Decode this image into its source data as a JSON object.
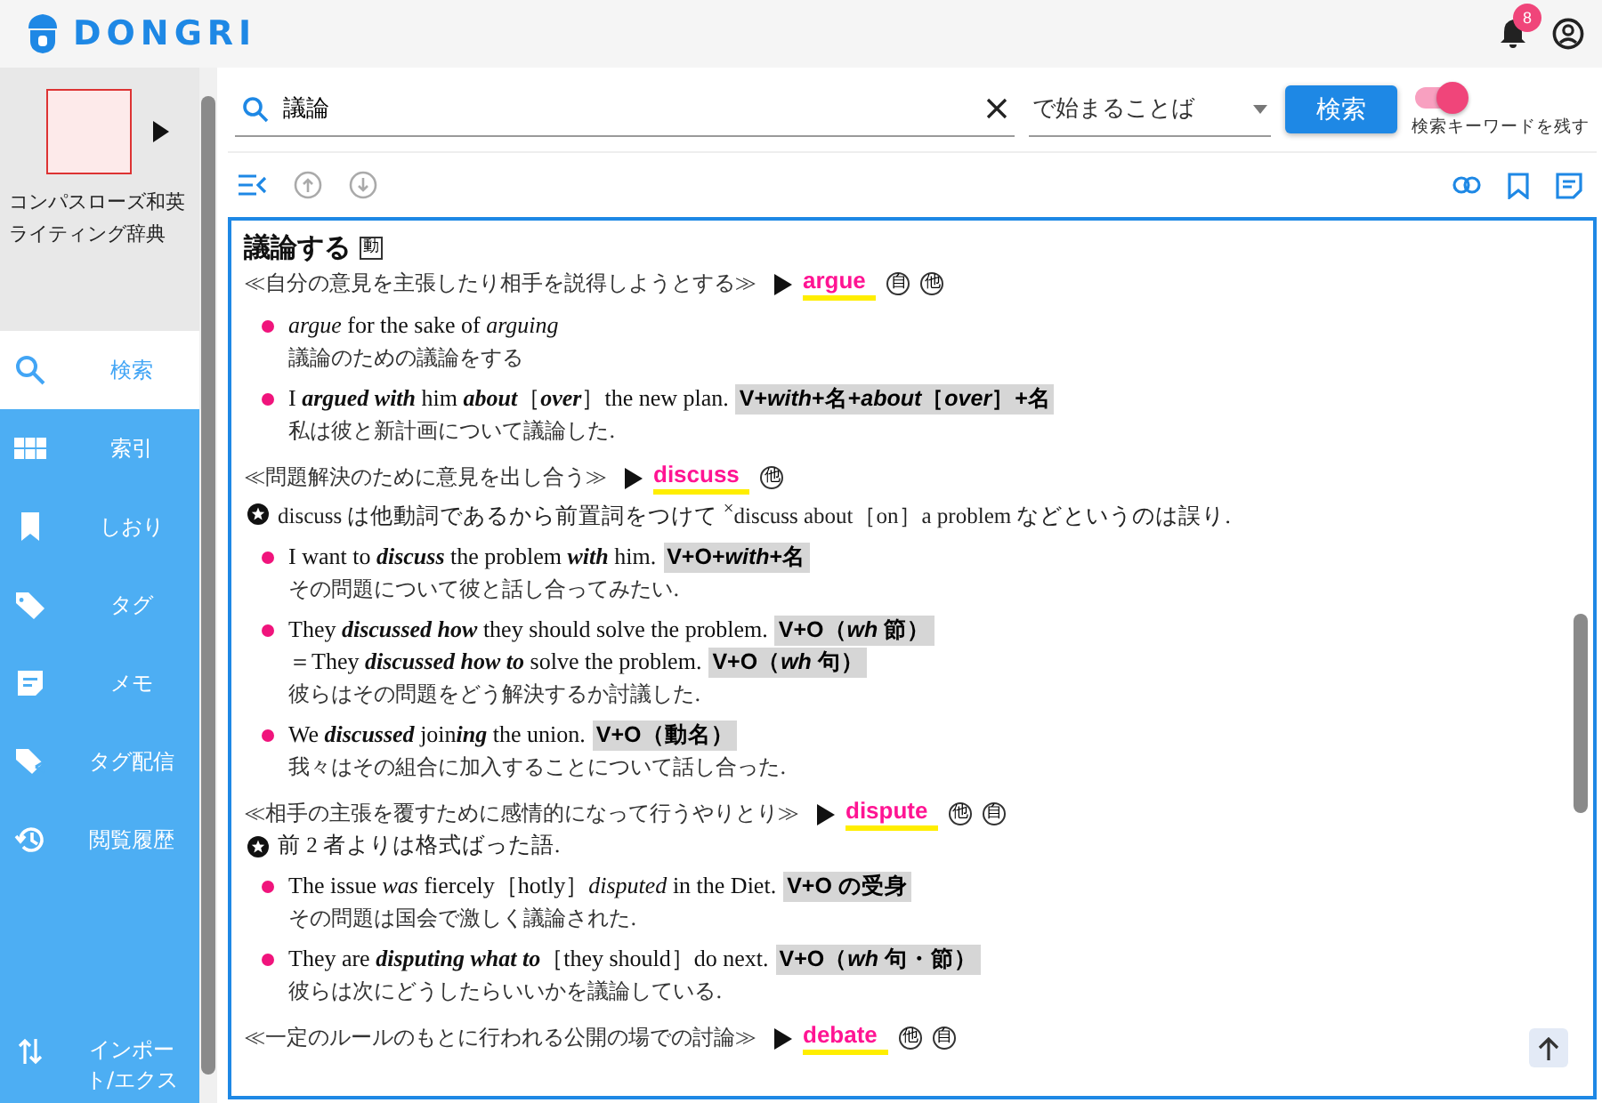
{
  "header": {
    "brand": "DONGRI",
    "notifications": "8"
  },
  "sidebar": {
    "dictionary": {
      "title": "コンパスローズ和英ライティング辞典"
    },
    "items": [
      {
        "label": "検索",
        "selected": true
      },
      {
        "label": "索引",
        "selected": false
      },
      {
        "label": "しおり",
        "selected": false
      },
      {
        "label": "タグ",
        "selected": false
      },
      {
        "label": "メモ",
        "selected": false
      },
      {
        "label": "タグ配信",
        "selected": false
      },
      {
        "label": "閲覧履歴",
        "selected": false
      },
      {
        "label": "インポート/エクス",
        "selected": false
      }
    ]
  },
  "search": {
    "query": "議論",
    "mode": "で始まることば",
    "button": "検索",
    "keep_keyword": {
      "label": "検索キーワードを残す",
      "on": true
    }
  },
  "entry": {
    "headword": "議論する",
    "pos": "動",
    "senses": [
      {
        "gloss": "≪自分の意見を主張したり相手を説得しようとする≫",
        "word": "argue",
        "marks": [
          "自",
          "他"
        ],
        "examples": [
          {
            "lines": [
              {
                "en": "*argue* for the sake of *arguing*"
              }
            ],
            "ja": "議論のための議論をする"
          },
          {
            "lines": [
              {
                "en": "I **argued with** him **about**［**over**］the new plan.",
                "pattern": "V+*with*+名+*about*［*over*］+名"
              }
            ],
            "ja": "私は彼と新計画について議論した."
          }
        ]
      },
      {
        "gloss": "≪問題解決のために意見を出し合う≫",
        "word": "discuss",
        "marks": [
          "他"
        ],
        "note": "discuss は他動詞であるから前置詞をつけて $^{×}$discuss about［on］a problem などというのは誤り.",
        "examples": [
          {
            "lines": [
              {
                "en": "I want to **discuss** the problem **with** him.",
                "pattern": "V+O+*with*+名"
              }
            ],
            "ja": "その問題について彼と話し合ってみたい."
          },
          {
            "lines": [
              {
                "en": "They **discussed how** they should solve the problem.",
                "pattern": "V+O（*wh* 節）"
              },
              {
                "en": "＝They **discussed how to** solve the problem.",
                "pattern": "V+O（*wh* 句）"
              }
            ],
            "ja": "彼らはその問題をどう解決するか討議した."
          },
          {
            "lines": [
              {
                "en": "We **discussed** join**ing** the union.",
                "pattern": "V+O（動名）"
              }
            ],
            "ja": "我々はその組合に加入することについて話し合った."
          }
        ]
      },
      {
        "gloss": "≪相手の主張を覆すために感情的になって行うやりとり≫",
        "word": "dispute",
        "marks": [
          "他",
          "自"
        ],
        "note": "前 2 者よりは格式ばった語.",
        "examples": [
          {
            "lines": [
              {
                "en": "The issue *was* fiercely［hotly］*disputed* in the Diet.",
                "pattern": "V+O の受身"
              }
            ],
            "ja": "その問題は国会で激しく議論された."
          },
          {
            "lines": [
              {
                "en": "They are **disputing what to**［they should］do next.",
                "pattern": "V+O（*wh* 句・節）"
              }
            ],
            "ja": "彼らは次にどうしたらいいかを議論している."
          }
        ]
      },
      {
        "gloss": "≪一定のルールのもとに行われる公開の場での討論≫",
        "word": "debate",
        "marks": [
          "他",
          "自"
        ]
      }
    ]
  }
}
